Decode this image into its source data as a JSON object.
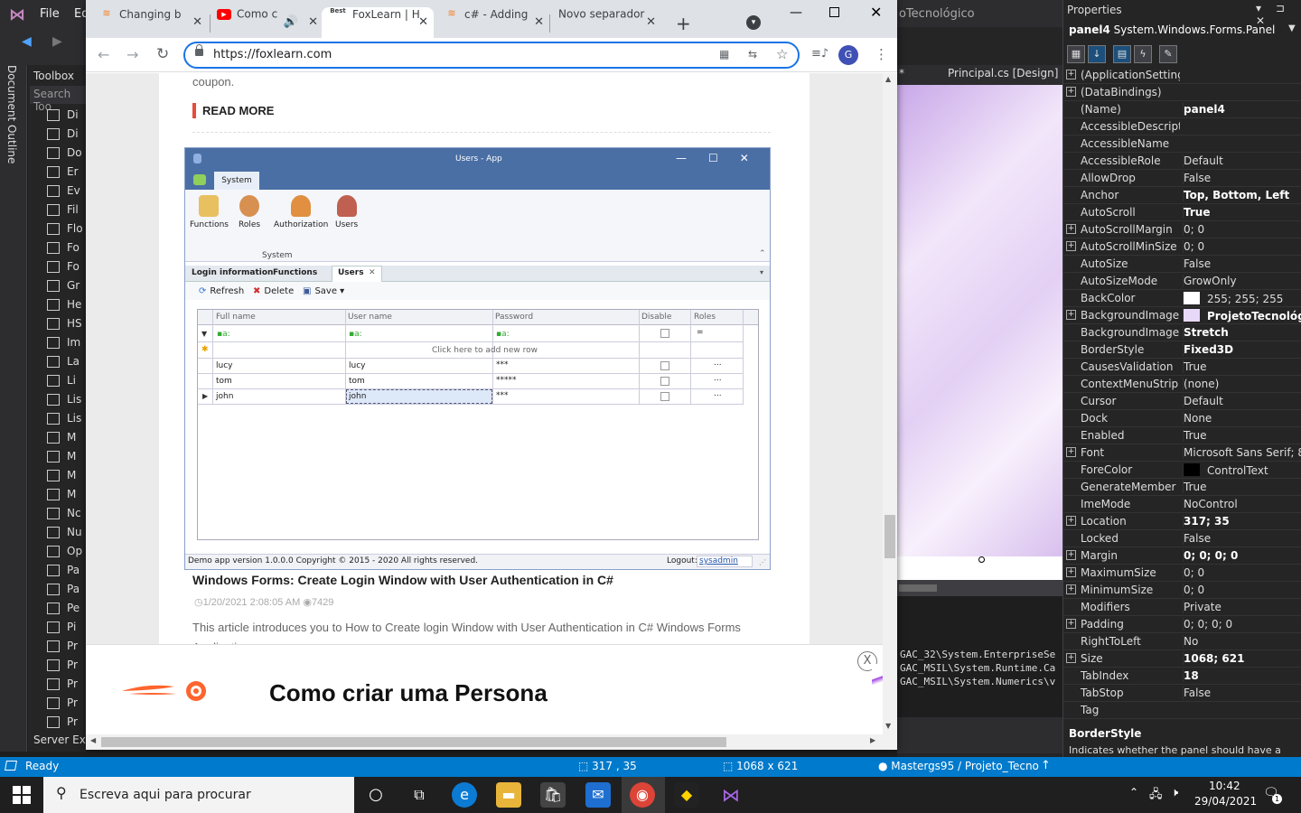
{
  "vs": {
    "menu_file": "File",
    "menu_edit": "Ed",
    "doc_outline": "Document Outline",
    "toolbox_title": "Toolbox",
    "toolbox_search": "Search Too",
    "toolbox_items": [
      "Di",
      "Di",
      "Do",
      "Er",
      "Ev",
      "Fil",
      "Flo",
      "Fo",
      "Fo",
      "Gr",
      "He",
      "HS",
      "Im",
      "La",
      "Li",
      "Lis",
      "Lis",
      "M",
      "M",
      "M",
      "M",
      "Nc",
      "Nu",
      "Op",
      "Pa",
      "Pa",
      "Pe",
      "Pi",
      "Pr",
      "Pr",
      "Pr",
      "Pr",
      "Pr"
    ],
    "server_explorer": "Server Expl",
    "designer_title": "oTecnológico",
    "designer_tab_star": "*",
    "designer_tab": "Principal.cs [Design]",
    "output_lines": [
      "GAC_32\\System.EnterpriseSe",
      "GAC_MSIL\\System.Runtime.Ca",
      "GAC_MSIL\\System.Numerics\\v"
    ]
  },
  "properties": {
    "title": "Properties",
    "object_name": "panel4",
    "object_type": "System.Windows.Forms.Panel",
    "rows": [
      {
        "name": "(ApplicationSettings",
        "value": "",
        "exp": "+"
      },
      {
        "name": "(DataBindings)",
        "value": "",
        "exp": "+"
      },
      {
        "name": "(Name)",
        "value": "panel4",
        "bold": true
      },
      {
        "name": "AccessibleDescriptio",
        "value": ""
      },
      {
        "name": "AccessibleName",
        "value": ""
      },
      {
        "name": "AccessibleRole",
        "value": "Default"
      },
      {
        "name": "AllowDrop",
        "value": "False"
      },
      {
        "name": "Anchor",
        "value": "Top, Bottom, Left",
        "bold": true
      },
      {
        "name": "AutoScroll",
        "value": "True",
        "bold": true
      },
      {
        "name": "AutoScrollMargin",
        "value": "0; 0",
        "exp": "+"
      },
      {
        "name": "AutoScrollMinSize",
        "value": "0; 0",
        "exp": "+"
      },
      {
        "name": "AutoSize",
        "value": "False"
      },
      {
        "name": "AutoSizeMode",
        "value": "GrowOnly"
      },
      {
        "name": "BackColor",
        "value": "255; 255; 255",
        "swatch": "#ffffff"
      },
      {
        "name": "BackgroundImage",
        "value": "ProjetoTecnológ",
        "bold": true,
        "exp": "+",
        "swatch": "#e8d8f8"
      },
      {
        "name": "BackgroundImageLa",
        "value": "Stretch",
        "bold": true
      },
      {
        "name": "BorderStyle",
        "value": "Fixed3D",
        "bold": true
      },
      {
        "name": "CausesValidation",
        "value": "True"
      },
      {
        "name": "ContextMenuStrip",
        "value": "(none)"
      },
      {
        "name": "Cursor",
        "value": "Default"
      },
      {
        "name": "Dock",
        "value": "None"
      },
      {
        "name": "Enabled",
        "value": "True"
      },
      {
        "name": "Font",
        "value": "Microsoft Sans Serif; 8",
        "exp": "+"
      },
      {
        "name": "ForeColor",
        "value": "ControlText",
        "swatch": "#000000"
      },
      {
        "name": "GenerateMember",
        "value": "True"
      },
      {
        "name": "ImeMode",
        "value": "NoControl"
      },
      {
        "name": "Location",
        "value": "317; 35",
        "bold": true,
        "exp": "+"
      },
      {
        "name": "Locked",
        "value": "False"
      },
      {
        "name": "Margin",
        "value": "0; 0; 0; 0",
        "bold": true,
        "exp": "+"
      },
      {
        "name": "MaximumSize",
        "value": "0; 0",
        "exp": "+"
      },
      {
        "name": "MinimumSize",
        "value": "0; 0",
        "exp": "+"
      },
      {
        "name": "Modifiers",
        "value": "Private"
      },
      {
        "name": "Padding",
        "value": "0; 0; 0; 0",
        "exp": "+"
      },
      {
        "name": "RightToLeft",
        "value": "No"
      },
      {
        "name": "Size",
        "value": "1068; 621",
        "bold": true,
        "exp": "+"
      },
      {
        "name": "TabIndex",
        "value": "18",
        "bold": true
      },
      {
        "name": "TabStop",
        "value": "False"
      },
      {
        "name": "Tag",
        "value": ""
      }
    ],
    "desc_title": "BorderStyle",
    "desc_text": "Indicates whether the panel should have a border."
  },
  "status": {
    "ready": "Ready",
    "position": "317 , 35",
    "size": "1068 x 621",
    "repo": "Mastergs95 / Projeto_Tecno"
  },
  "taskbar": {
    "search_placeholder": "Escreva aqui para procurar",
    "time": "10:42",
    "date": "29/04/2021",
    "notifications": "1"
  },
  "chrome": {
    "tabs": [
      {
        "label": "Changing b",
        "favicon": "so-icon"
      },
      {
        "label": "Como c",
        "favicon": "youtube-icon"
      },
      {
        "label": "FoxLearn | H",
        "favicon": "best-icon",
        "favicon_text": "Best",
        "active": true
      },
      {
        "label": "c# - Adding",
        "favicon": "so-icon"
      },
      {
        "label": "Novo separador",
        "favicon": ""
      }
    ],
    "url": "https://foxlearn.com",
    "profile_initial": "G"
  },
  "page": {
    "coupon_text": "coupon.",
    "read_more": "READ MORE",
    "article_title": "Windows Forms: Create Login Window with User Authentication in C#",
    "article_date": "1/20/2021 2:08:05 AM",
    "article_views": "7429",
    "article_text": "This article introduces you to How to Create login Window with User Authentication in C# Windows Forms Application.",
    "ad_text": "Como criar uma Persona",
    "ad_close": "X"
  },
  "app": {
    "title": "Users - App",
    "ribbon_tab": "System",
    "ribbon_buttons": [
      "Functions",
      "Roles",
      "Authorization",
      "Users"
    ],
    "ribbon_group": "System",
    "doc_tabs": [
      "Login information",
      "Functions",
      "Users"
    ],
    "toolbar": [
      "Refresh",
      "Delete",
      "Save"
    ],
    "grid_headers": [
      "Full name",
      "User name",
      "Password",
      "Disable",
      "Roles"
    ],
    "new_row_text": "Click here to add new row",
    "rows": [
      {
        "full": "lucy",
        "user": "lucy",
        "pass": "***",
        "roles": "..."
      },
      {
        "full": "tom",
        "user": "tom",
        "pass": "*****",
        "roles": "..."
      },
      {
        "full": "john",
        "user": "john",
        "pass": "***",
        "roles": "..."
      }
    ],
    "status_text": "Demo app version 1.0.0.0 Copyright © 2015 - 2020 All rights reserved.",
    "logout_label": "Logout:",
    "logout_user": "sysadmin"
  }
}
